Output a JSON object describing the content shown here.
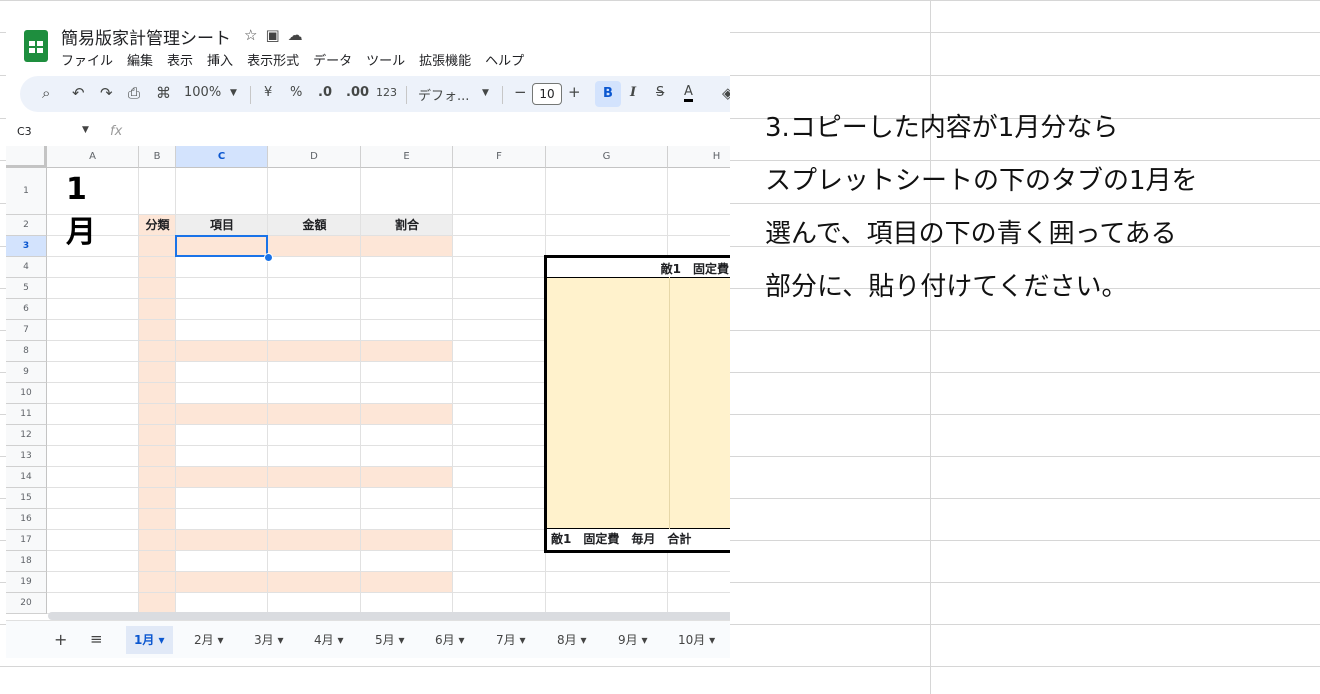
{
  "app": {
    "title": "簡易版家計管理シート",
    "title_icons": [
      "star-icon",
      "folder-move-icon",
      "cloud-icon"
    ],
    "menu": [
      "ファイル",
      "編集",
      "表示",
      "挿入",
      "表示形式",
      "データ",
      "ツール",
      "拡張機能",
      "ヘルプ"
    ]
  },
  "toolbar": {
    "zoom": "100%",
    "currency": "¥",
    "percent": "%",
    "dec_decrease": ".0",
    "dec_increase": ".00",
    "number_format": "123",
    "font": "デフォ...",
    "font_size": "10",
    "minus": "−",
    "plus": "+",
    "bold": "B",
    "italic": "I",
    "strike": "S",
    "text_color": "A"
  },
  "formula_bar": {
    "name_box": "C3",
    "fx": "fx"
  },
  "columns": [
    "A",
    "B",
    "C",
    "D",
    "E",
    "F",
    "G",
    "H"
  ],
  "rows": [
    "1",
    "2",
    "3",
    "4",
    "5",
    "6",
    "7",
    "8",
    "9",
    "10",
    "11",
    "12",
    "13",
    "14",
    "15",
    "16",
    "17",
    "18",
    "19",
    "20"
  ],
  "sheet": {
    "title_cell": "1月",
    "headers": {
      "category": "分類",
      "item": "項目",
      "amount": "金額",
      "ratio": "割合"
    },
    "chart_top": "敵1　固定費",
    "chart_bottom": "敵1　固定費　毎月　合計"
  },
  "tabs": [
    "1月",
    "2月",
    "3月",
    "4月",
    "5月",
    "6月",
    "7月",
    "8月",
    "9月",
    "10月"
  ],
  "active_tab": "1月",
  "instruction": [
    "3.コピーした内容が1月分なら",
    "スプレットシートの下のタブの1月を",
    "選んで、項目の下の青く囲ってある",
    "部分に、貼り付けてください。"
  ],
  "colors": {
    "peach": "#fde6d7",
    "chart_fill": "#fff2cc",
    "selection": "#1a73e8",
    "sheets_green": "#1e8e3e"
  }
}
